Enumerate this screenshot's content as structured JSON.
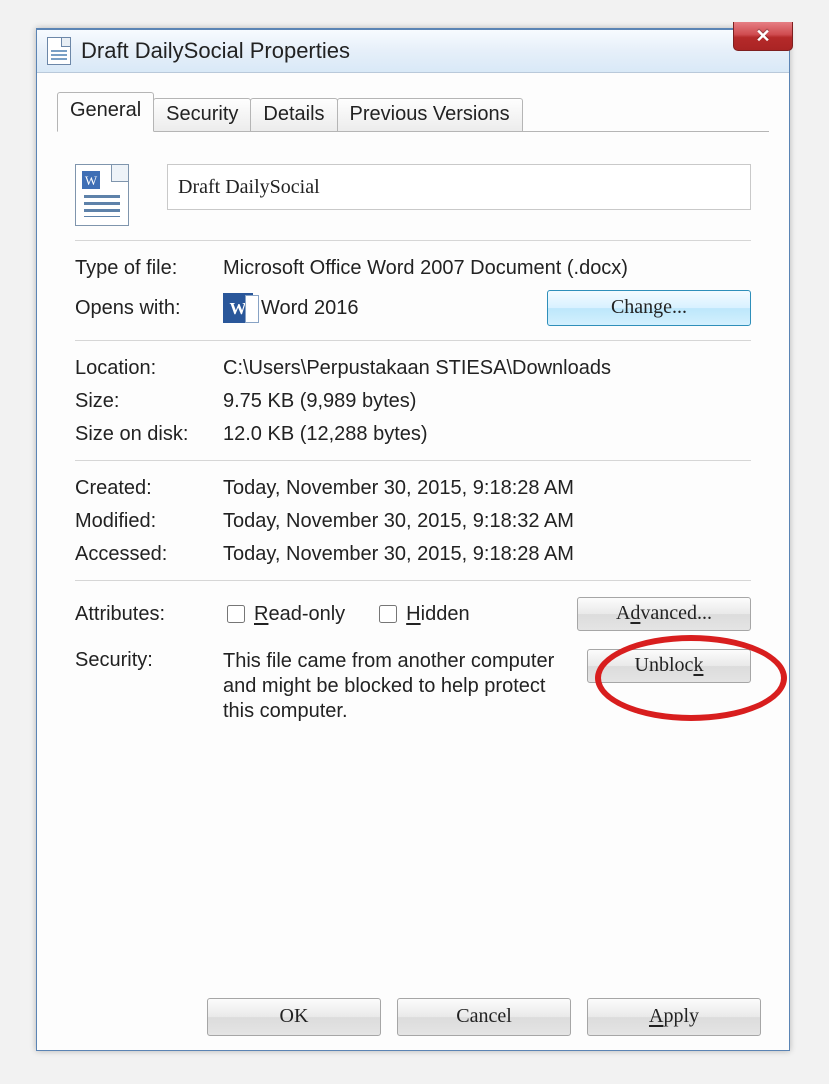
{
  "window": {
    "title": "Draft DailySocial Properties",
    "close_label": "✕"
  },
  "tabs": [
    {
      "label": "General",
      "active": true
    },
    {
      "label": "Security",
      "active": false
    },
    {
      "label": "Details",
      "active": false
    },
    {
      "label": "Previous Versions",
      "active": false
    }
  ],
  "file": {
    "name": "Draft DailySocial"
  },
  "type_of_file": {
    "label": "Type of file:",
    "value": "Microsoft Office Word 2007 Document (.docx)"
  },
  "opens_with": {
    "label": "Opens with:",
    "app": "Word 2016",
    "change_label": "Change..."
  },
  "location": {
    "label": "Location:",
    "value": "C:\\Users\\Perpustakaan STIESA\\Downloads"
  },
  "size": {
    "label": "Size:",
    "value": "9.75 KB (9,989 bytes)"
  },
  "size_on_disk": {
    "label": "Size on disk:",
    "value": "12.0 KB (12,288 bytes)"
  },
  "created": {
    "label": "Created:",
    "value": "Today, November 30, 2015, 9:18:28 AM"
  },
  "modified": {
    "label": "Modified:",
    "value": "Today, November 30, 2015, 9:18:32 AM"
  },
  "accessed": {
    "label": "Accessed:",
    "value": "Today, November 30, 2015, 9:18:28 AM"
  },
  "attributes": {
    "label": "Attributes:",
    "readonly_label": "Read-only",
    "hidden_label": "Hidden",
    "advanced_label": "Advanced..."
  },
  "security": {
    "label": "Security:",
    "text": "This file came from another computer and might be blocked to help protect this computer.",
    "unblock_label": "Unblock"
  },
  "buttons": {
    "ok": "OK",
    "cancel": "Cancel",
    "apply": "Apply"
  },
  "mnemonics": {
    "readonly": "R",
    "hidden": "H",
    "advanced": "d",
    "unblock": "k",
    "apply": "A"
  }
}
